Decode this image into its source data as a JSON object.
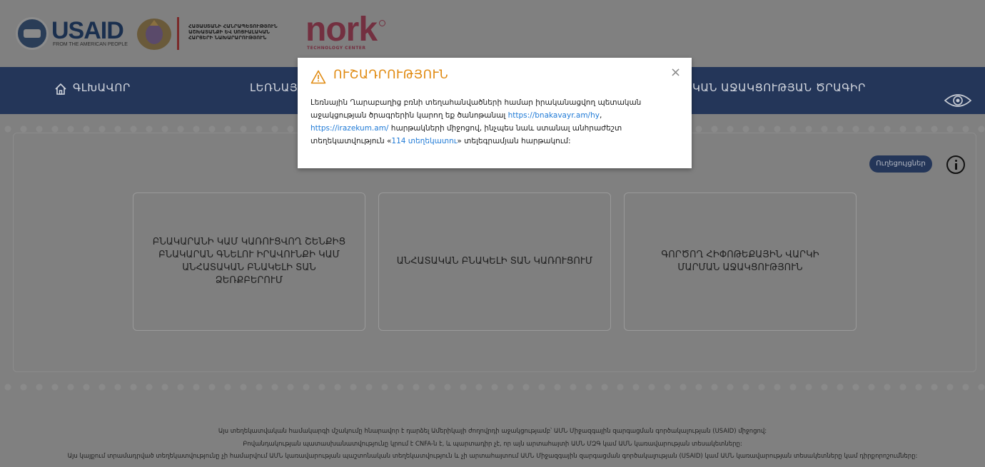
{
  "header": {
    "usaid_text": "USAID",
    "usaid_sub": "FROM THE AMERICAN PEOPLE",
    "ministry_lines": [
      "ՀԱՅԱՍՏԱՆԻ ՀԱՆՐԱՊԵՏՈՒԹՅՈՒՆ",
      "ԱՇԽԱՏԱՆՔԻ ԵՎ ՍՈՑԻԱԼԱԿԱՆ",
      "ՀԱՐՑԵՐԻ ՆԱԽԱՐԱՐՈՒԹՅՈՒՆ"
    ],
    "nork_text": "nork",
    "nork_sub": "TECHNOLOGY CENTER"
  },
  "nav": {
    "home": "ԳԼԽԱՎՈՐ",
    "item2": "ԼԵՌՆԱՅԻՆ",
    "item3": "ԿԱՆ ԱՋԱԿՑՈՒԹՅԱՆ ԾՐԱԳԻՐ"
  },
  "main": {
    "docs_button": "Ուղեցույցներ",
    "cards": [
      "ԲՆԱԿԱՐԱՆԻ ԿԱՄ ԿԱՌՈՒՑՎՈՂ ՇԵՆՔԻՑ ԲՆԱԿԱՐԱՆ ԳՆԵԼՈՒ ԻՐԱՎՈՒՆՔԻ ԿԱՄ ԱՆՀԱՏԱԿԱՆ ԲՆԱԿԵԼԻ ՏԱՆ ՁԵՌՔԲԵՐՈՒՄ",
      "ԱՆՀԱՏԱԿԱՆ ԲՆԱԿԵԼԻ ՏԱՆ ԿԱՌՈՒՑՈՒՄ",
      "ԳՈՐԾՈՂ ՀԻՓՈԹԵՔԱՅԻՆ ՎԱՐԿԻ ՄԱՐՄԱՆ ԱՋԱԿՑՈՒԹՅՈՒՆ"
    ]
  },
  "modal": {
    "title": "ՈՒՇԱԴՐՈՒԹՅՈՒՆ",
    "text1": "Լեռնային Ղարաբաղից բռնի տեղահանվածների համար իրականացվող պետական աջակցության ծրագրերին կարող եք ծանոթանալ ",
    "link1": "https://bnakavayr.am/hy",
    "text2": ", ",
    "link2": "https://irazekum.am/",
    "text3": " հարթակների միջոցով, ինչպես նաև ստանալ անհրաժեշտ տեղեկատվություն «",
    "link3": "114 տեղեկատու",
    "text4": "» տելեգրամյան հարթակում:"
  },
  "footer": {
    "line1": "Այս տեղեկատվական համակարգի մշակումը հնարավոր է դարձել Ամերիկայի ժողովրդի աջակցությամբ՝ ԱՄՆ Միջազգային զարգացման գործակալության (USAID) միջոցով:",
    "line2": "Բովանդակության պատասխանատվությունը կրում է CNFA-ն է, և պարտադիր չէ, որ այն արտահայտի ԱՄՆ ՄԶԳ կամ ԱՄՆ կառավարության տեսակետները:",
    "line3": "Այս կայքում տրամադրված տեղեկատվությունը չի համարվում ԱՄՆ կառավարության պաշտոնական տեղեկատվություն և չի արտահայտում ԱՄՆ Միջազգային զարգացման գործակալության (USAID) կամ ԱՄՆ կառավարության տեսակետները կամ դիրքորոշումները:"
  },
  "colors": {
    "nav_bg": "#243659",
    "overlay_bg": "#808080",
    "warning": "#e08a10",
    "link": "#1f7ad6"
  }
}
